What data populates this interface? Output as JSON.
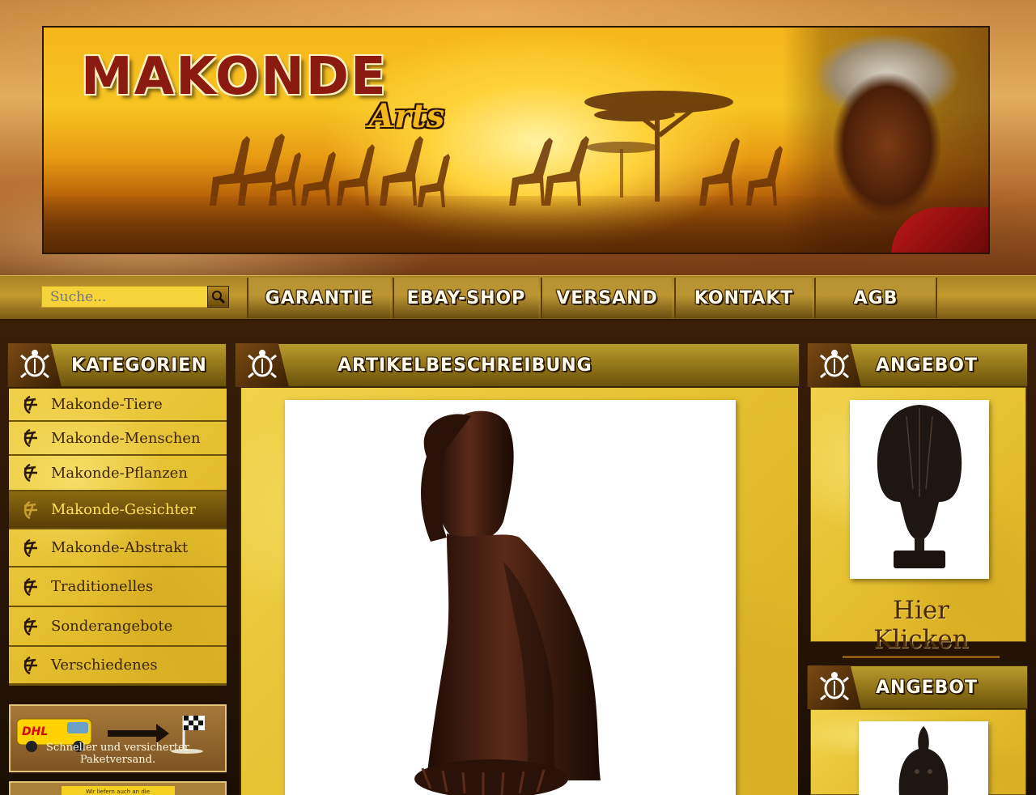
{
  "header": {
    "logo_title": "MAKONDE",
    "logo_subtitle": "Arts"
  },
  "search": {
    "placeholder": "Suche..."
  },
  "nav": {
    "items": [
      "GARANTIE",
      "EBAY-SHOP",
      "VERSAND",
      "KONTAKT",
      "AGB"
    ]
  },
  "sidebar": {
    "title": "KATEGORIEN",
    "items": [
      {
        "label": "Makonde-Tiere"
      },
      {
        "label": "Makonde-Menschen"
      },
      {
        "label": "Makonde-Pflanzen"
      },
      {
        "label": "Makonde-Gesichter",
        "active": true
      },
      {
        "label": "Makonde-Abstrakt"
      },
      {
        "label": "Traditionelles"
      },
      {
        "label": "Sonderangebote"
      },
      {
        "label": "Verschiedenes"
      }
    ],
    "promo_text": "Schneller und versicherter Paketversand.",
    "promo_brand": "DHL",
    "promo2_text": "Wir liefern auch an die"
  },
  "main": {
    "title": "ARTIKELBESCHREIBUNG"
  },
  "offers": [
    {
      "title": "ANGEBOT",
      "link": "Hier Klicken"
    },
    {
      "title": "ANGEBOT"
    }
  ],
  "colors": {
    "accent_gold": "#f0d24a",
    "dark_brown": "#3a2404",
    "active_text": "#ffe25a"
  }
}
